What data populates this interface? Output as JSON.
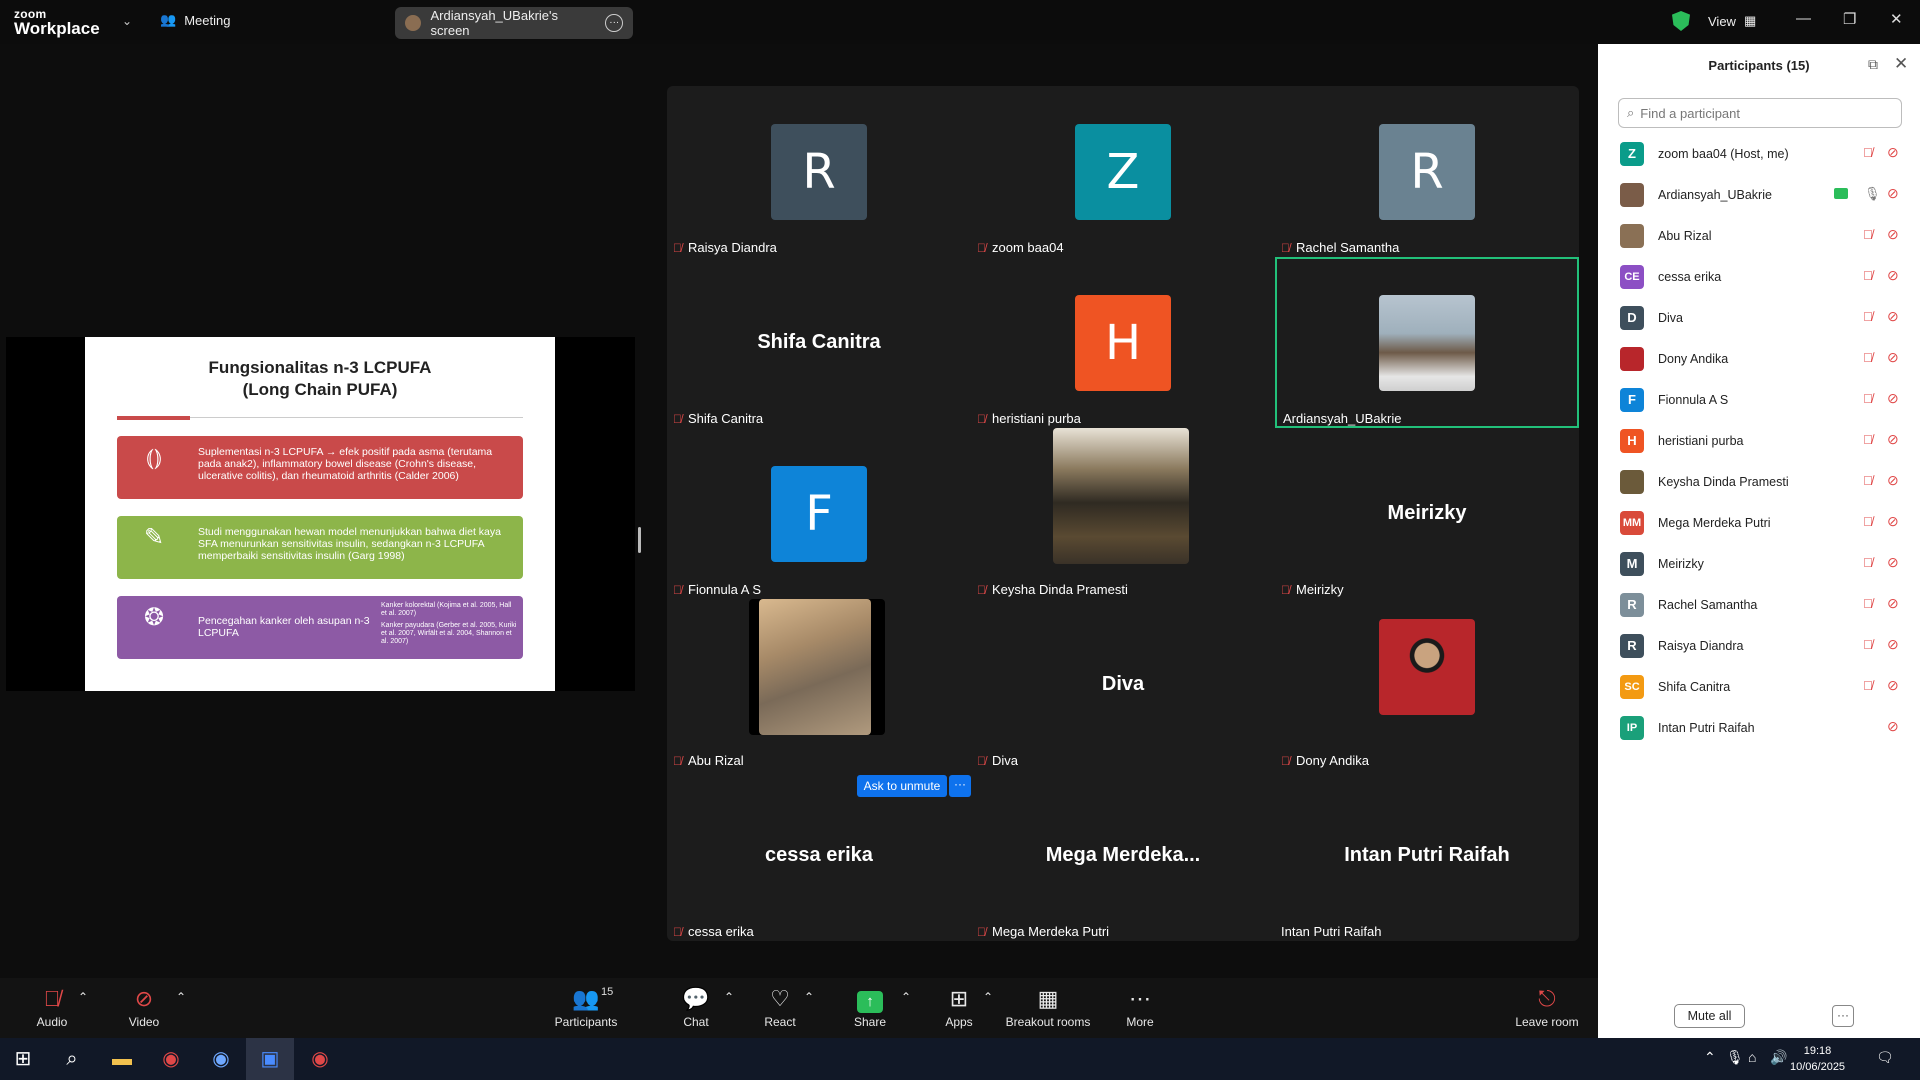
{
  "app": {
    "logo_top": "zoom",
    "logo_bottom": "Workplace",
    "meeting_label": "Meeting",
    "screen_label": "Ardiansyah_UBakrie's screen",
    "view_label": "View"
  },
  "slide": {
    "title_line1": "Fungsionalitas n-3 LCPUFA",
    "title_line2": "(Long Chain PUFA)",
    "card1": "Suplementasi n-3 LCPUFA → efek positif pada asma (terutama pada anak2), inflammatory bowel disease (Crohn's disease, ulcerative colitis), dan rheumatoid arthritis (Calder 2006)",
    "card2": "Studi menggunakan hewan model menunjukkan bahwa diet kaya SFA menurunkan sensitivitas insulin, sedangkan n-3 LCPUFA memperbaiki sensitivitas insulin (Garg 1998)",
    "card3": "Pencegahan kanker oleh asupan n-3 LCPUFA",
    "card3_ref1": "Kanker kolorektal (Kojima et al. 2005, Hall et al. 2007)",
    "card3_ref2": "Kanker payudara (Gerber et al. 2005, Kuriki et al. 2007, Wirfält et al. 2004, Shannon et al. 2007)"
  },
  "gallery": {
    "tiles": [
      {
        "name": "Raisya Diandra",
        "initial": "R",
        "color": "#3e4f5c",
        "muted": true
      },
      {
        "name": "zoom baa04",
        "initial": "Z",
        "color": "#0a8fa0",
        "muted": true
      },
      {
        "name": "Rachel Samantha",
        "initial": "R",
        "color": "#6a8291",
        "muted": true
      },
      {
        "name": "Shifa Canitra",
        "big_name": "Shifa Canitra",
        "muted": true
      },
      {
        "name": "heristiani purba",
        "initial": "H",
        "color": "#ef5423",
        "muted": true
      },
      {
        "name": "Ardiansyah_UBakrie",
        "muted": false
      },
      {
        "name": "Fionnula A S",
        "initial": "F",
        "color": "#0e84d8",
        "muted": true
      },
      {
        "name": "Keysha Dinda Pramesti",
        "muted": true
      },
      {
        "name": "Meirizky",
        "big_name": "Meirizky",
        "muted": true
      },
      {
        "name": "Abu Rizal",
        "muted": true
      },
      {
        "name": "Diva",
        "big_name": "Diva",
        "muted": true
      },
      {
        "name": "Dony Andika",
        "muted": true
      },
      {
        "name": "cessa erika",
        "big_name": "cessa erika",
        "muted": true
      },
      {
        "name": "Mega Merdeka Putri",
        "big_name": "Mega  Merdeka...",
        "muted": true
      },
      {
        "name": "Intan Putri Raifah",
        "big_name": "Intan Putri Raifah",
        "muted": false
      }
    ],
    "ask_unmute": "Ask to unmute"
  },
  "panel": {
    "title": "Participants (15)",
    "search_placeholder": "Find a participant",
    "participants": [
      {
        "name": "zoom baa04 (Host, me)",
        "initial": "Z",
        "color": "#0a9c8a"
      },
      {
        "name": "Ardiansyah_UBakrie",
        "initial": "",
        "color": "#7a5c48"
      },
      {
        "name": "Abu Rizal",
        "initial": "",
        "color": "#8a7055"
      },
      {
        "name": "cessa erika",
        "initial": "CE",
        "color": "#8c4fc4"
      },
      {
        "name": "Diva",
        "initial": "D",
        "color": "#3e4f5c"
      },
      {
        "name": "Dony Andika",
        "initial": "",
        "color": "#b8262b"
      },
      {
        "name": "Fionnula A S",
        "initial": "F",
        "color": "#0e84d8"
      },
      {
        "name": "heristiani purba",
        "initial": "H",
        "color": "#ef5423"
      },
      {
        "name": "Keysha Dinda Pramesti",
        "initial": "",
        "color": "#6b5a3a"
      },
      {
        "name": "Mega Merdeka Putri",
        "initial": "MM",
        "color": "#d94a3a"
      },
      {
        "name": "Meirizky",
        "initial": "M",
        "color": "#3e4f5c"
      },
      {
        "name": "Rachel Samantha",
        "initial": "R",
        "color": "#7d8f9a"
      },
      {
        "name": "Raisya Diandra",
        "initial": "R",
        "color": "#3e4f5c"
      },
      {
        "name": "Shifa Canitra",
        "initial": "SC",
        "color": "#f39a12"
      },
      {
        "name": "Intan Putri Raifah",
        "initial": "IP",
        "color": "#1aa07a"
      }
    ],
    "mute_all": "Mute all"
  },
  "toolbar": {
    "audio": "Audio",
    "video": "Video",
    "participants": "Participants",
    "participants_count": "15",
    "chat": "Chat",
    "react": "React",
    "share": "Share",
    "apps": "Apps",
    "breakout": "Breakout rooms",
    "more": "More",
    "leave": "Leave room"
  },
  "taskbar": {
    "time": "19:18",
    "date": "10/06/2025"
  }
}
